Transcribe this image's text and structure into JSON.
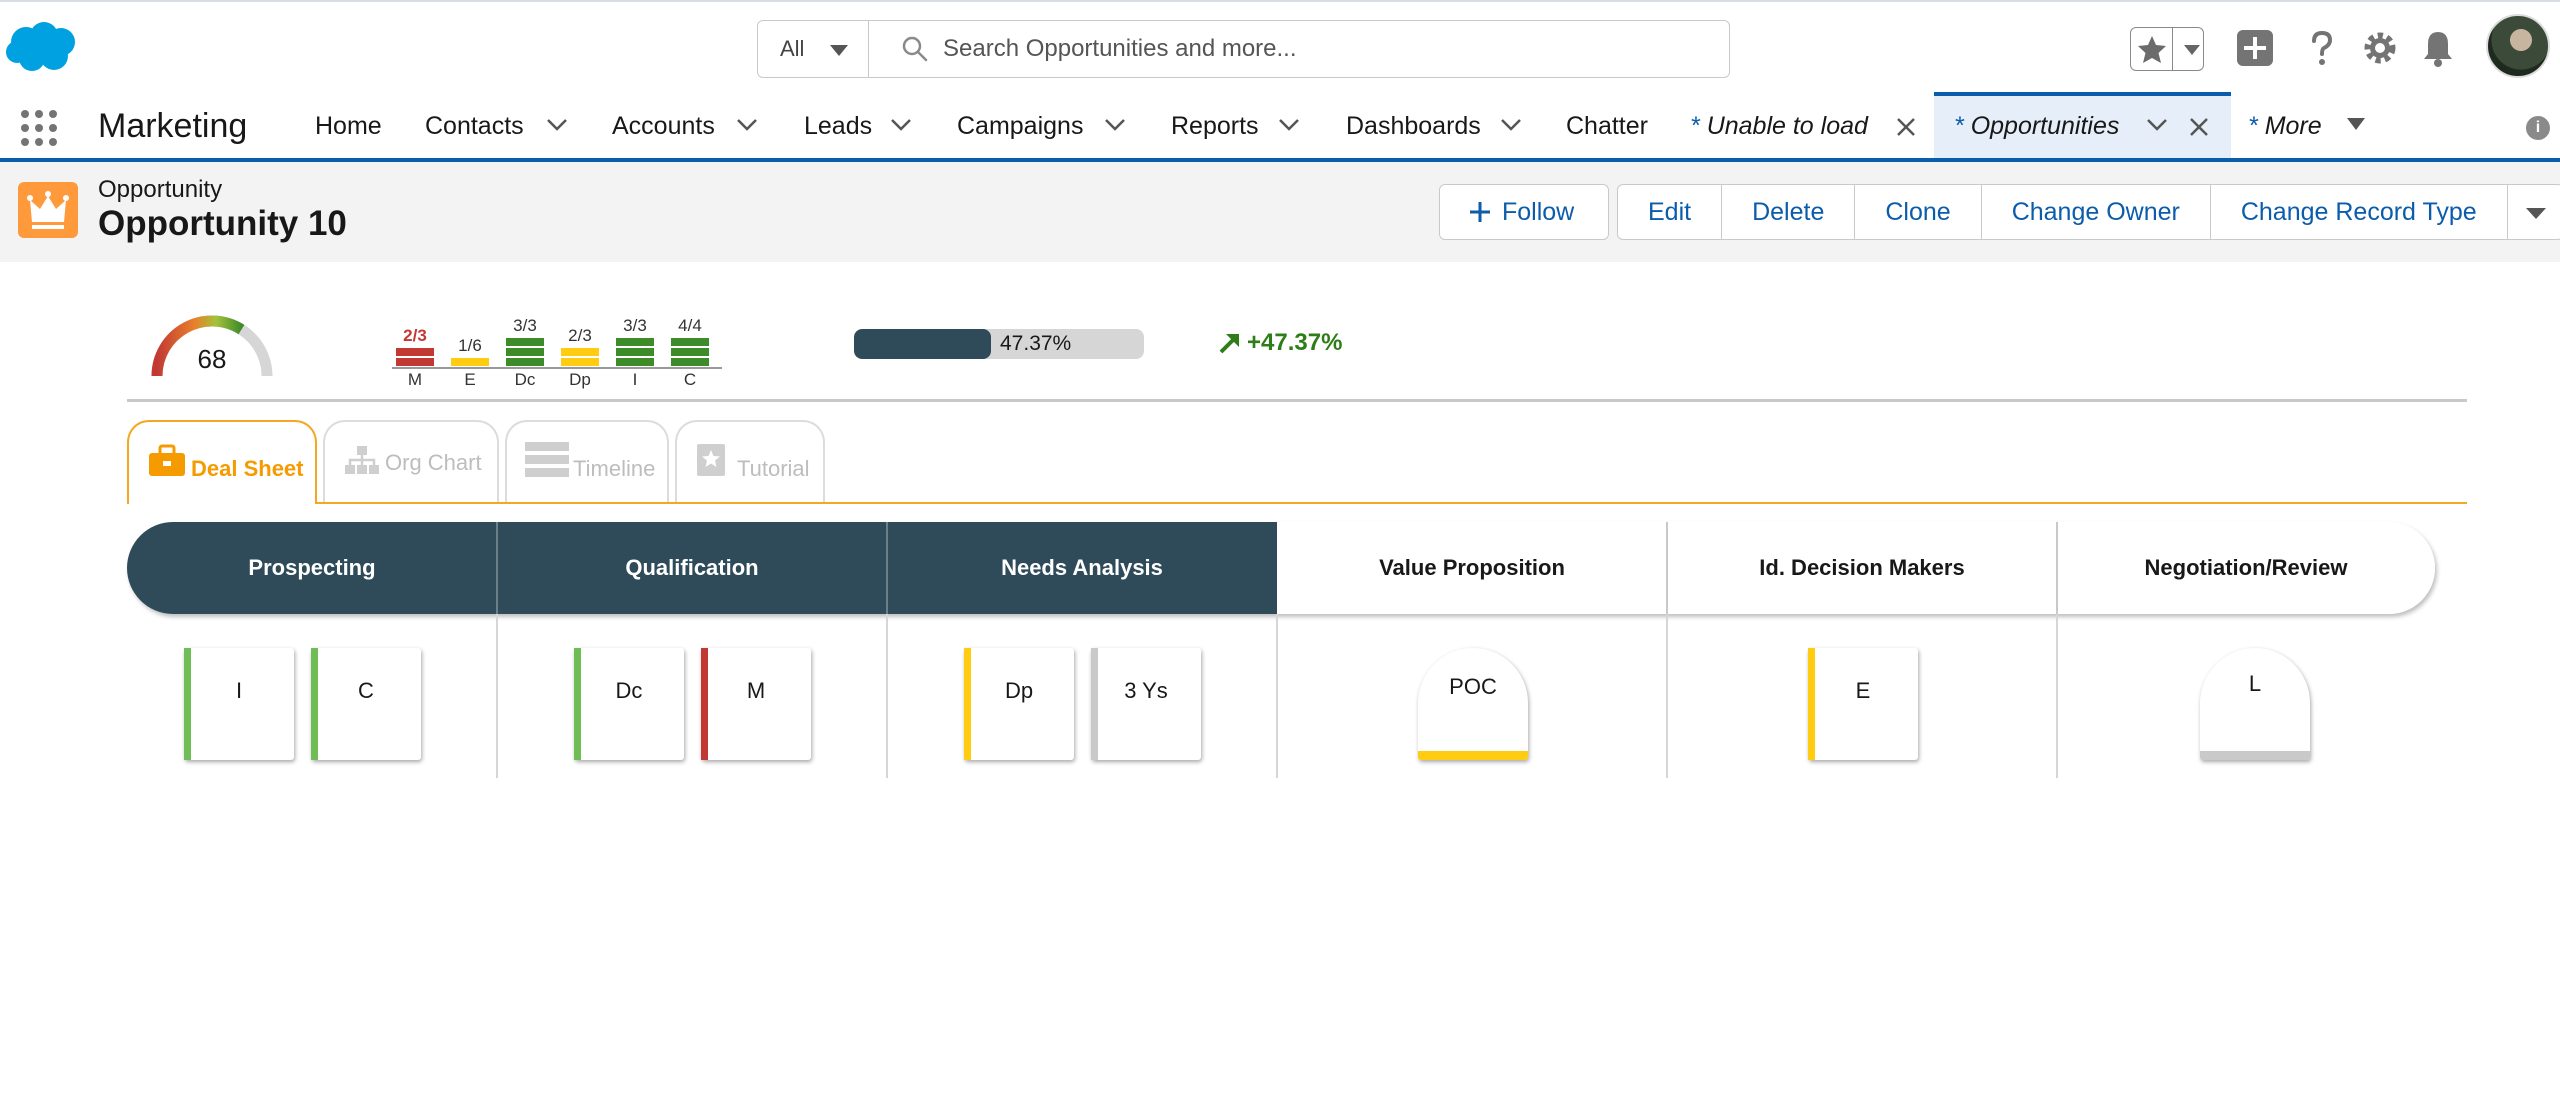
{
  "header": {
    "search_scope": "All",
    "search_placeholder": "Search Opportunities and more..."
  },
  "nav": {
    "app_name": "Marketing",
    "items": [
      {
        "label": "Home"
      },
      {
        "label": "Contacts"
      },
      {
        "label": "Accounts"
      },
      {
        "label": "Leads"
      },
      {
        "label": "Campaigns"
      },
      {
        "label": "Reports"
      },
      {
        "label": "Dashboards"
      },
      {
        "label": "Chatter"
      }
    ],
    "tab_unable": "Unable to load",
    "tab_opportunities": "Opportunities",
    "tab_more": "More",
    "tab_star": "*"
  },
  "record": {
    "type_label": "Opportunity",
    "title": "Opportunity 10",
    "buttons": {
      "follow": "Follow",
      "edit": "Edit",
      "delete": "Delete",
      "clone": "Clone",
      "change_owner": "Change Owner",
      "change_record_type": "Change Record Type"
    }
  },
  "metrics": {
    "score": "68",
    "score_value": 68,
    "meddic": [
      {
        "letter": "M",
        "frac": "2/3",
        "filled": 2,
        "total": 3,
        "color": "#c23934"
      },
      {
        "letter": "E",
        "frac": "1/6",
        "filled": 1,
        "total": 6,
        "color": "#ffcc11"
      },
      {
        "letter": "Dc",
        "frac": "3/3",
        "filled": 3,
        "total": 3,
        "color": "#3e8b2a"
      },
      {
        "letter": "Dp",
        "frac": "2/3",
        "filled": 2,
        "total": 3,
        "color": "#ffcc11"
      },
      {
        "letter": "I",
        "frac": "3/3",
        "filled": 3,
        "total": 3,
        "color": "#3e8b2a"
      },
      {
        "letter": "C",
        "frac": "4/4",
        "filled": 4,
        "total": 4,
        "color": "#3e8b2a"
      }
    ],
    "progress_label": "47.37%",
    "progress_value": 0.4737,
    "trend_label": "+47.37%"
  },
  "apptabs": {
    "deal_sheet": "Deal Sheet",
    "org_chart": "Org Chart",
    "timeline": "Timeline",
    "tutorial": "Tutorial"
  },
  "stages": [
    {
      "name": "Prospecting",
      "status": "done"
    },
    {
      "name": "Qualification",
      "status": "done"
    },
    {
      "name": "Needs Analysis",
      "status": "done"
    },
    {
      "name": "Value Proposition",
      "status": "todo"
    },
    {
      "name": "Id. Decision Makers",
      "status": "todo"
    },
    {
      "name": "Negotiation/Review",
      "status": "todo"
    }
  ],
  "cards": {
    "prospecting": [
      "I",
      "C"
    ],
    "qualification": [
      "Dc",
      "M"
    ],
    "needs_analysis": [
      "Dp",
      "3 Ys"
    ],
    "value_proposition": [
      "POC"
    ],
    "decision_makers": [
      "E"
    ],
    "negotiation": [
      "L"
    ]
  },
  "colors": {
    "brand_blue": "#0b5cab",
    "stage_done": "#2f4b5a",
    "green": "#3e8b2a",
    "yellow": "#ffcc11",
    "red": "#c23934",
    "grey": "#c9c9c9",
    "orange": "#f5a623"
  }
}
